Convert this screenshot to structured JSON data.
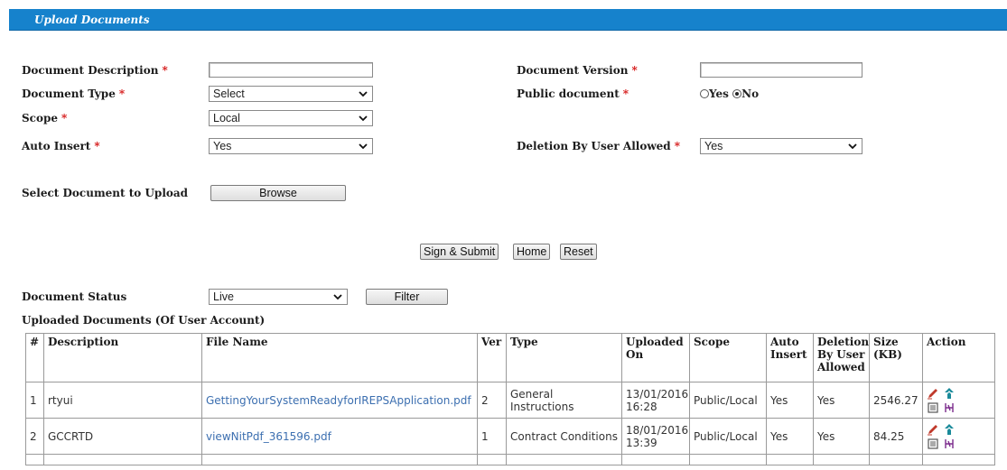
{
  "header": {
    "title": "Upload Documents"
  },
  "form": {
    "doc_description": {
      "label": "Document Description",
      "required_mark": "*",
      "value": ""
    },
    "doc_version": {
      "label": "Document Version",
      "required_mark": "*",
      "value": ""
    },
    "doc_type": {
      "label": "Document Type",
      "required_mark": "*",
      "value": "Select"
    },
    "public_document": {
      "label": "Public document",
      "required_mark": "*",
      "yes": "Yes",
      "no": "No",
      "selected": "No"
    },
    "scope": {
      "label": "Scope",
      "required_mark": "*",
      "value": "Local"
    },
    "auto_insert": {
      "label": "Auto Insert",
      "required_mark": "*",
      "value": "Yes"
    },
    "deletion_allowed": {
      "label": "Deletion By User Allowed",
      "required_mark": "*",
      "value": "Yes"
    },
    "select_document": {
      "label": "Select Document to Upload",
      "browse": "Browse"
    }
  },
  "actions": {
    "sign_submit": "Sign & Submit",
    "home": "Home",
    "reset": "Reset"
  },
  "filter": {
    "label": "Document Status",
    "value": "Live",
    "button": "Filter"
  },
  "table": {
    "caption": "Uploaded Documents (Of User Account)",
    "headers": [
      "#",
      "Description",
      "File Name",
      "Ver",
      "Type",
      "Uploaded On",
      "Scope",
      "Auto Insert",
      "Deletion By User Allowed",
      "Size (KB)",
      "Action"
    ],
    "rows": [
      {
        "num": "1",
        "description": "rtyui",
        "file_name": "GettingYourSystemReadyforIREPSApplication.pdf",
        "ver": "2",
        "type": "General Instructions",
        "uploaded_on": "13/01/2016 16:28",
        "scope": "Public/Local",
        "auto_insert": "Yes",
        "deletion": "Yes",
        "size": "2546.27"
      },
      {
        "num": "2",
        "description": "GCCRTD",
        "file_name": "viewNitPdf_361596.pdf",
        "ver": "1",
        "type": "Contract Conditions",
        "uploaded_on": "18/01/2016 13:39",
        "scope": "Public/Local",
        "auto_insert": "Yes",
        "deletion": "Yes",
        "size": "84.25"
      }
    ]
  },
  "icons": {
    "edit": "pencil-icon",
    "upload": "up-arrows-icon",
    "view": "document-icon",
    "split": "split-icon"
  },
  "colors": {
    "titlebar": "#1682cc",
    "required": "#d41111",
    "link": "#3c6fb0"
  }
}
